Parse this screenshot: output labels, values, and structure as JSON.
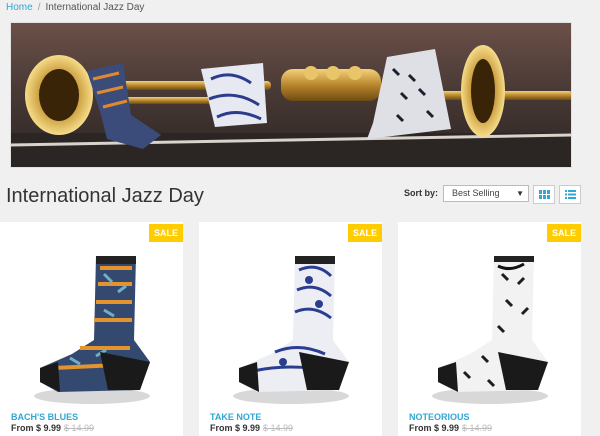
{
  "breadcrumb": {
    "home": "Home",
    "separator": "/",
    "current": "International Jazz Day"
  },
  "page": {
    "title": "International Jazz Day"
  },
  "toolbar": {
    "sort_label": "Sort by:",
    "sort_value": "Best Selling",
    "grid_view_icon": "grid-icon",
    "list_view_icon": "list-icon"
  },
  "products": [
    {
      "name": "BACH'S BLUES",
      "price": "From $ 9.99",
      "compare_price": "$ 14.99",
      "badge": "SALE"
    },
    {
      "name": "TAKE NOTE",
      "price": "From $ 9.99",
      "compare_price": "$ 14.99",
      "badge": "SALE"
    },
    {
      "name": "NOTEORIOUS",
      "price": "From $ 9.99",
      "compare_price": "$ 14.99",
      "badge": "SALE"
    }
  ],
  "colors": {
    "accent": "#2fa8d5",
    "sale_badge": "#ffcc00",
    "background": "#f0f0f0"
  }
}
